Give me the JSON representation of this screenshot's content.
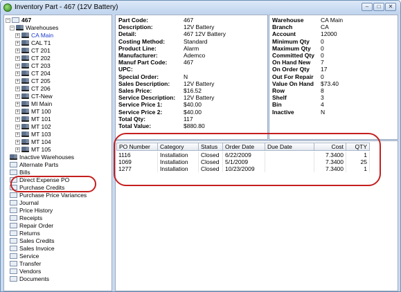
{
  "window": {
    "title": "Inventory Part - 467 (12V Battery)",
    "buttons": [
      "–",
      "□",
      "✕"
    ]
  },
  "tree": {
    "root": "467",
    "warehouses_label": "Warehouses",
    "warehouses": [
      "CA Main",
      "CAL T1",
      "CT 201",
      "CT 202",
      "CT 203",
      "CT 204",
      "CT 205",
      "CT 206",
      "CT-New",
      "MI Main",
      "MT 100",
      "MT 101",
      "MT 102",
      "MT 103",
      "MT 104",
      "MT 105"
    ],
    "nodes": [
      "Inactive Warehouses",
      "Alternate Parts",
      "Bills",
      "Direct Expense PO",
      "Purchase Credits",
      "Purchase Price Variances",
      "Journal",
      "Price History",
      "Receipts",
      "Repair Order",
      "Returns",
      "Sales Credits",
      "Sales Invoice",
      "Service",
      "Transfer",
      "Vendors",
      "Documents"
    ]
  },
  "part_info": [
    {
      "k": "Part Code:",
      "v": "467"
    },
    {
      "k": "Description:",
      "v": "12V Battery"
    },
    {
      "k": "Detail:",
      "v": "467 12V Battery"
    },
    {
      "k": "Costing Method:",
      "v": "Standard"
    },
    {
      "k": "Product Line:",
      "v": "Alarm"
    },
    {
      "k": "Manufacturer:",
      "v": "Ademco"
    },
    {
      "k": "Manuf Part Code:",
      "v": "467"
    },
    {
      "k": "UPC:",
      "v": ""
    },
    {
      "k": "Special Order:",
      "v": "N"
    },
    {
      "k": "Sales Description:",
      "v": "12V Battery"
    },
    {
      "k": "Sales Price:",
      "v": "$16.52"
    },
    {
      "k": "Service Description:",
      "v": "12V Battery"
    },
    {
      "k": "Service Price 1:",
      "v": "$40.00"
    },
    {
      "k": "Service Price 2:",
      "v": "$40.00"
    },
    {
      "k": "Total Qty:",
      "v": "117"
    },
    {
      "k": "Total Value:",
      "v": "$880.80"
    }
  ],
  "warehouse_info": [
    {
      "k": "Warehouse",
      "v": "CA Main"
    },
    {
      "k": "Branch",
      "v": "CA"
    },
    {
      "k": "Account",
      "v": "12000"
    },
    {
      "k": "Minimum Qty",
      "v": "0"
    },
    {
      "k": "Maximum Qty",
      "v": "0"
    },
    {
      "k": "Committed Qty",
      "v": "0"
    },
    {
      "k": "On Hand New",
      "v": "7"
    },
    {
      "k": "On Order Qty",
      "v": "17"
    },
    {
      "k": "Out For Repair",
      "v": "0"
    },
    {
      "k": "Value On Hand",
      "v": "$73.40"
    },
    {
      "k": "Row",
      "v": "8"
    },
    {
      "k": "Shelf",
      "v": "3"
    },
    {
      "k": "Bin",
      "v": "4"
    },
    {
      "k": "Inactive",
      "v": "N"
    }
  ],
  "grid": {
    "columns": [
      "PO Number",
      "Category",
      "Status",
      "Order Date",
      "Due Date",
      "Cost",
      "QTY"
    ],
    "rows": [
      [
        "1116",
        "Installation",
        "Closed",
        "6/22/2009",
        "",
        "7.3400",
        "1"
      ],
      [
        "1069",
        "Installation",
        "Closed",
        "5/1/2009",
        "",
        "7.3400",
        "25"
      ],
      [
        "1277",
        "Installation",
        "Closed",
        "10/23/2009",
        "",
        "7.3400",
        "1"
      ]
    ]
  },
  "colors": {
    "highlight": "#c41e1e",
    "selected_text": "#1a3bcc"
  }
}
